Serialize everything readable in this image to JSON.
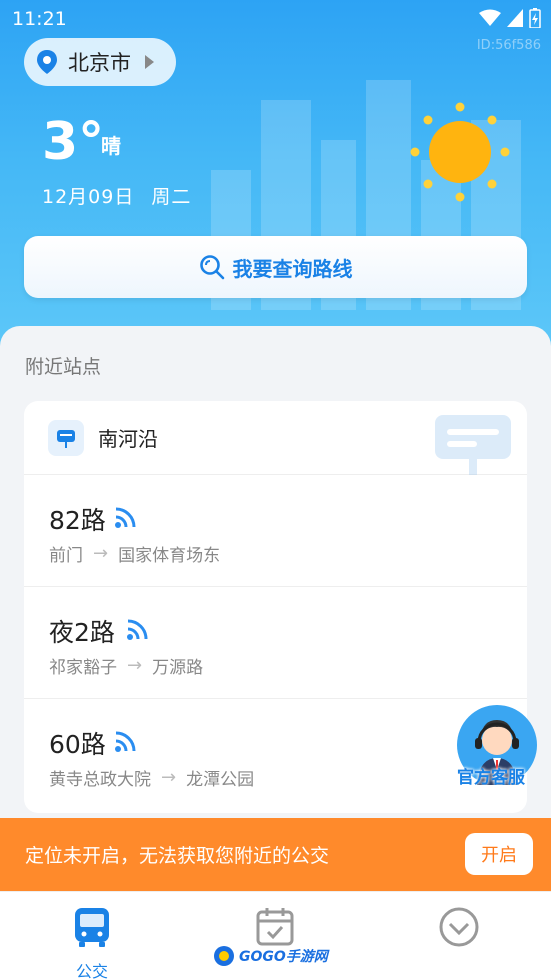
{
  "status_bar": {
    "time": "11:21",
    "watermark": "ID:56f586"
  },
  "location": {
    "city": "北京市"
  },
  "weather": {
    "temperature": "3°",
    "condition": "晴",
    "date": "12月09日",
    "weekday": "周二"
  },
  "search": {
    "label": "我要查询路线"
  },
  "nearby": {
    "title": "附近站点",
    "station": "南河沿",
    "routes": [
      {
        "name": "82路",
        "from": "前门",
        "to": "国家体育场东"
      },
      {
        "name": "夜2路",
        "from": "祁家豁子",
        "to": "万源路"
      },
      {
        "name": "60路",
        "from": "黄寺总政大院",
        "to": "龙潭公园"
      }
    ]
  },
  "customer_service": {
    "label": "官方客服"
  },
  "location_banner": {
    "text": "定位未开启，无法获取您附近的公交",
    "button": "开启"
  },
  "tabs": [
    {
      "label": "公交",
      "active": true
    },
    {
      "label": ""
    },
    {
      "label": ""
    }
  ],
  "logo": {
    "text": "GOGO手游网"
  },
  "colors": {
    "accent": "#1a82e6",
    "banner": "#ff8a2b",
    "hero_top": "#2da3f4",
    "sun": "#ffb40f"
  }
}
